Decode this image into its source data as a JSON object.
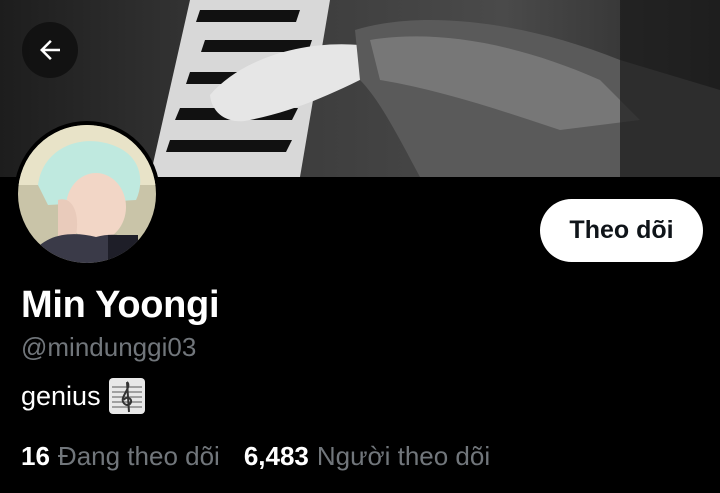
{
  "header": {
    "back_icon": "arrow-left-icon",
    "banner_description_icon": "piano-banner-image"
  },
  "profile": {
    "display_name": "Min Yoongi",
    "handle": "@mindunggi03",
    "bio_text": "genius",
    "bio_emoji": "🎼",
    "follow_label": "Theo dõi"
  },
  "stats": {
    "following_count": "16",
    "following_label": "Đang theo dõi",
    "followers_count": "6,483",
    "followers_label": "Người theo dõi"
  },
  "colors": {
    "background": "#000000",
    "primary_text": "#ffffff",
    "secondary_text": "#71767b",
    "button_bg": "#ffffff",
    "button_text": "#0f1419"
  }
}
